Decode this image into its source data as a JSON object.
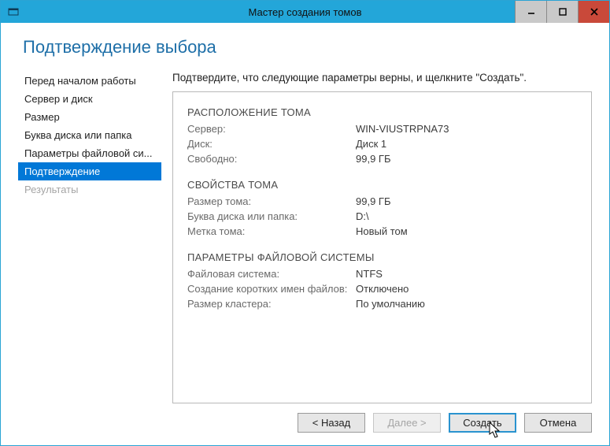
{
  "titlebar": {
    "title": "Мастер создания томов"
  },
  "page_title": "Подтверждение выбора",
  "nav": {
    "items": [
      {
        "label": "Перед началом работы",
        "state": "normal"
      },
      {
        "label": "Сервер и диск",
        "state": "normal"
      },
      {
        "label": "Размер",
        "state": "normal"
      },
      {
        "label": "Буква диска или папка",
        "state": "normal"
      },
      {
        "label": "Параметры файловой си...",
        "state": "normal"
      },
      {
        "label": "Подтверждение",
        "state": "selected"
      },
      {
        "label": "Результаты",
        "state": "disabled"
      }
    ]
  },
  "instruction": "Подтвердите, что следующие параметры верны, и щелкните \"Создать\".",
  "sections": {
    "location": {
      "head": "РАСПОЛОЖЕНИЕ ТОМА",
      "rows": [
        {
          "k": "Сервер:",
          "v": "WIN-VIUSTRPNA73"
        },
        {
          "k": "Диск:",
          "v": "Диск 1"
        },
        {
          "k": "Свободно:",
          "v": "99,9 ГБ"
        }
      ]
    },
    "props": {
      "head": "СВОЙСТВА ТОМА",
      "rows": [
        {
          "k": "Размер тома:",
          "v": "99,9 ГБ"
        },
        {
          "k": "Буква диска или папка:",
          "v": "D:\\"
        },
        {
          "k": "Метка тома:",
          "v": "Новый том"
        }
      ]
    },
    "fs": {
      "head": "ПАРАМЕТРЫ ФАЙЛОВОЙ СИСТЕМЫ",
      "rows": [
        {
          "k": "Файловая система:",
          "v": "NTFS"
        },
        {
          "k": "Создание коротких имен файлов:",
          "v": "Отключено"
        },
        {
          "k": "Размер кластера:",
          "v": "По умолчанию"
        }
      ]
    }
  },
  "footer": {
    "back": "< Назад",
    "next": "Далее >",
    "create": "Создать",
    "cancel": "Отмена"
  }
}
